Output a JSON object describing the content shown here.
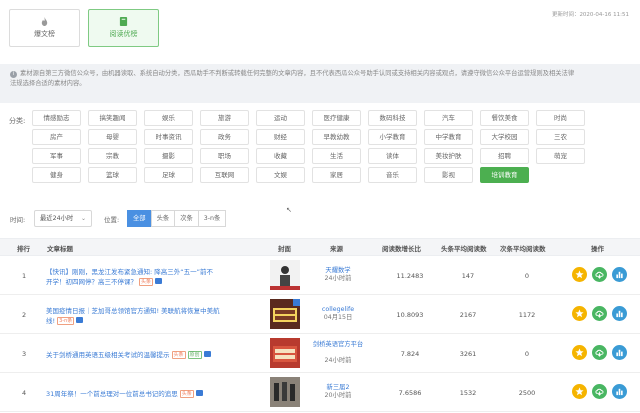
{
  "tabs": [
    {
      "label": "爆文榜",
      "icon": "flame-icon"
    },
    {
      "label": "阅读优榜",
      "icon": "book-icon"
    }
  ],
  "update_time": "更新时间：2020-04-16 11:51",
  "notice": {
    "line1": "素材源自第三方微信公众号，由机器读取、系统自动分类，西瓜助手不判断或转载任何完整的文章内容，且不代表西瓜公众号助手认同或支持相关内容或观点，请遵守微信公众平台运营规则及相关法律",
    "line2": "法规选择合适的素材内容。"
  },
  "categories_label": "分类:",
  "categories": [
    [
      "情感励志",
      "搞笑趣闻",
      "娱乐",
      "旅游",
      "运动",
      "医疗健康",
      "数码科技",
      "汽车",
      "餐饮美食",
      "时尚"
    ],
    [
      "房产",
      "母婴",
      "时事资讯",
      "政务",
      "财经",
      "早教幼教",
      "小学教育",
      "中学教育",
      "大学校园",
      "三农"
    ],
    [
      "军事",
      "宗教",
      "摄影",
      "职场",
      "收藏",
      "生活",
      "读体",
      "美妆护肤",
      "招聘",
      "萌宠"
    ],
    [
      "健身",
      "篮球",
      "足球",
      "互联网",
      "文娱",
      "家居",
      "音乐",
      "影视",
      "培训教育"
    ]
  ],
  "active_category": "培训教育",
  "filters": {
    "time_label": "时间:",
    "time_value": "最近24小时",
    "position_label": "位置:",
    "positions": [
      "全部",
      "头条",
      "次条",
      "3-n条"
    ],
    "active_position": "全部"
  },
  "table": {
    "headers": {
      "rank": "排行",
      "title": "文章标题",
      "cover": "封面",
      "source": "来源",
      "growth": "阅读数增长比",
      "head_avg": "头条平均阅读数",
      "second_avg": "次条平均阅读数",
      "ops": "操作"
    },
    "rows": [
      {
        "rank": "1",
        "title1": "【快讯】刚刚，黑龙江发布紧急通知: 降高三外“五一”前不",
        "title2": "开学！初四网停？高三不停课？",
        "tag": "头条",
        "tag_green": "",
        "source": "天耀数学",
        "time": "24小时前",
        "growth": "11.2483",
        "head": "147",
        "second": "0"
      },
      {
        "rank": "2",
        "title1": "美国疫情日报｜芝加哥总领馆官方通知! 美联航将恢复中美航",
        "title2": "线!",
        "tag": "3-n条",
        "tag_green": "",
        "source": "collegelife",
        "time": "04月15日",
        "growth": "10.8093",
        "head": "2167",
        "second": "1172"
      },
      {
        "rank": "3",
        "title1": "关于剑桥通用英语五级相关考试的温馨提示",
        "title2": "",
        "tag": "头条",
        "tag_green": "原创",
        "source": "剑桥英语官方平台",
        "time": "24小时前",
        "growth": "7.824",
        "head": "3261",
        "second": "0"
      },
      {
        "rank": "4",
        "title1": "31周年祭！一个前总理对一位前总书记的追思",
        "title2": "",
        "tag": "头条",
        "tag_green": "",
        "source": "新三届2",
        "time": "20小时前",
        "growth": "7.6586",
        "head": "1532",
        "second": "2500"
      }
    ]
  },
  "colors": {
    "accent_green": "#4caf50",
    "link_blue": "#3a7bd5",
    "star": "#f5b400"
  }
}
